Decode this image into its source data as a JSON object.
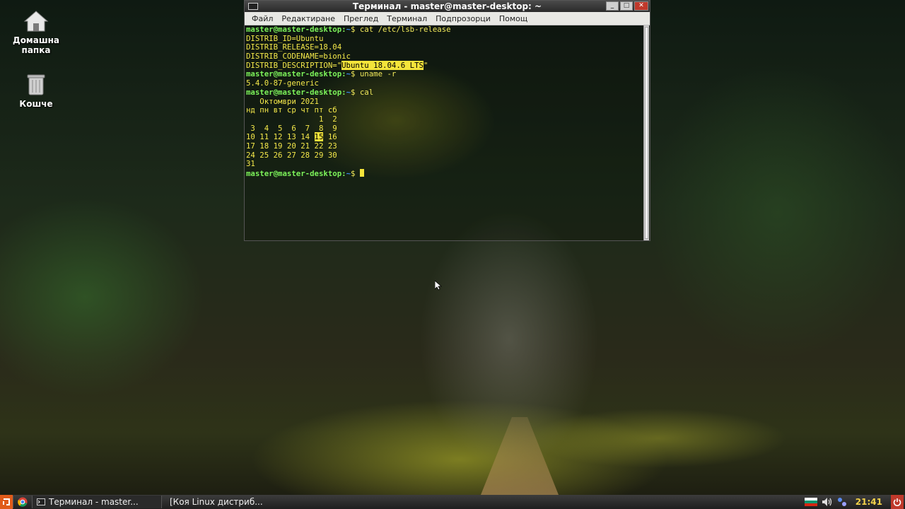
{
  "desktop": {
    "icons": [
      {
        "label": "Домашна папка",
        "icon": "home-folder-icon"
      },
      {
        "label": "Кошче",
        "icon": "trash-icon"
      }
    ]
  },
  "terminal": {
    "title": "Терминал - master@master-desktop: ~",
    "menu": [
      "Файл",
      "Редактиране",
      "Преглед",
      "Терминал",
      "Подпрозорци",
      "Помощ"
    ],
    "prompt_user": "master@master-desktop",
    "prompt_path": "~",
    "lines": {
      "cmd1": "cat /etc/lsb-release",
      "l_id": "DISTRIB_ID=Ubuntu",
      "l_rel": "DISTRIB_RELEASE=18.04",
      "l_code": "DISTRIB_CODENAME=bionic",
      "l_desc_pre": "DISTRIB_DESCRIPTION=\"",
      "l_desc_hl": "Ubuntu 18.04.6 LTS",
      "l_desc_post": "\"",
      "cmd2": "uname -r",
      "kernel": "5.4.0-87-generic",
      "cmd3": "cal",
      "cal_title": "   Октомври 2021",
      "cal_head": "нд пн вт ср чт пт сб",
      "cal_r1": "                1  2",
      "cal_r2": " 3  4  5  6  7  8  9",
      "cal_r3_pre": "10 11 12 13 14 ",
      "cal_today": "15",
      "cal_r3_post": " 16",
      "cal_r4": "17 18 19 20 21 22 23",
      "cal_r5": "24 25 26 27 28 29 30",
      "cal_r6": "31"
    }
  },
  "taskbar": {
    "tasks": [
      {
        "label": "Терминал - master..."
      },
      {
        "label": "[Коя Linux дистриб..."
      }
    ],
    "clock": "21:41",
    "language_flag_colors": [
      "#ffffff",
      "#00966e",
      "#d62612"
    ]
  }
}
